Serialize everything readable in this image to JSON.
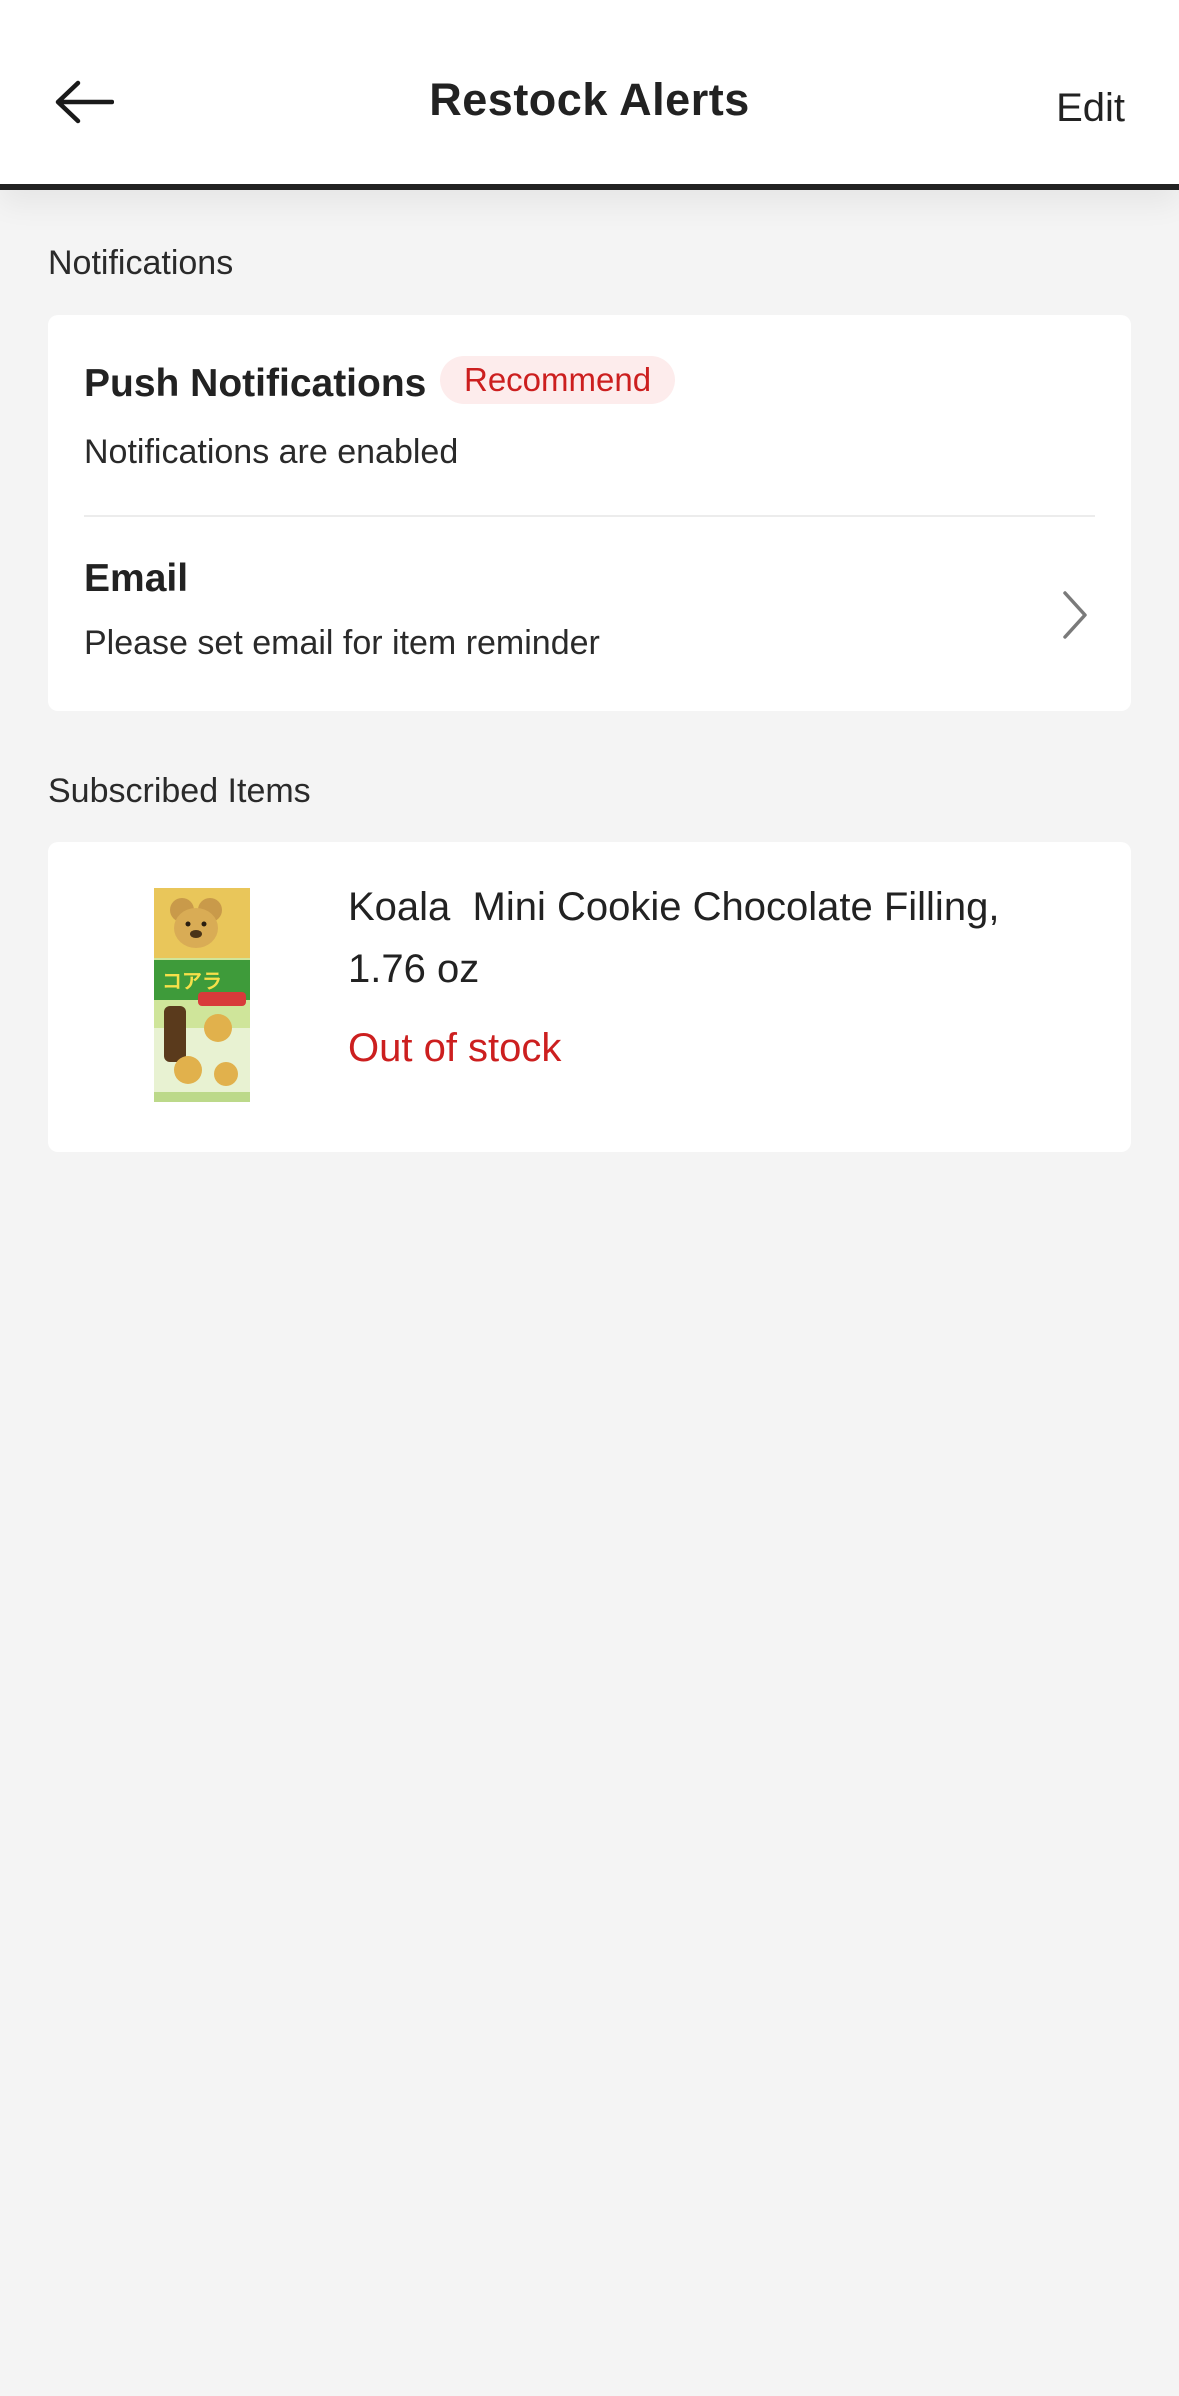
{
  "header": {
    "title": "Restock Alerts",
    "edit_label": "Edit",
    "back_icon": "arrow-left-icon"
  },
  "notifications": {
    "section_label": "Notifications",
    "push": {
      "title": "Push Notifications",
      "badge": "Recommend",
      "status": "Notifications are enabled"
    },
    "email": {
      "title": "Email",
      "subtitle": "Please set email for item reminder",
      "icon": "chevron-right-icon"
    }
  },
  "subscribed": {
    "section_label": "Subscribed Items",
    "items": [
      {
        "name": "Koala  Mini Cookie Chocolate Filling, 1.76 oz",
        "status": "Out of stock",
        "image": "koala-cookie-box-image"
      }
    ]
  },
  "colors": {
    "background": "#f4f4f4",
    "card": "#ffffff",
    "accent_red": "#cc1f1f",
    "badge_bg": "#fdecec",
    "text": "#222222"
  }
}
